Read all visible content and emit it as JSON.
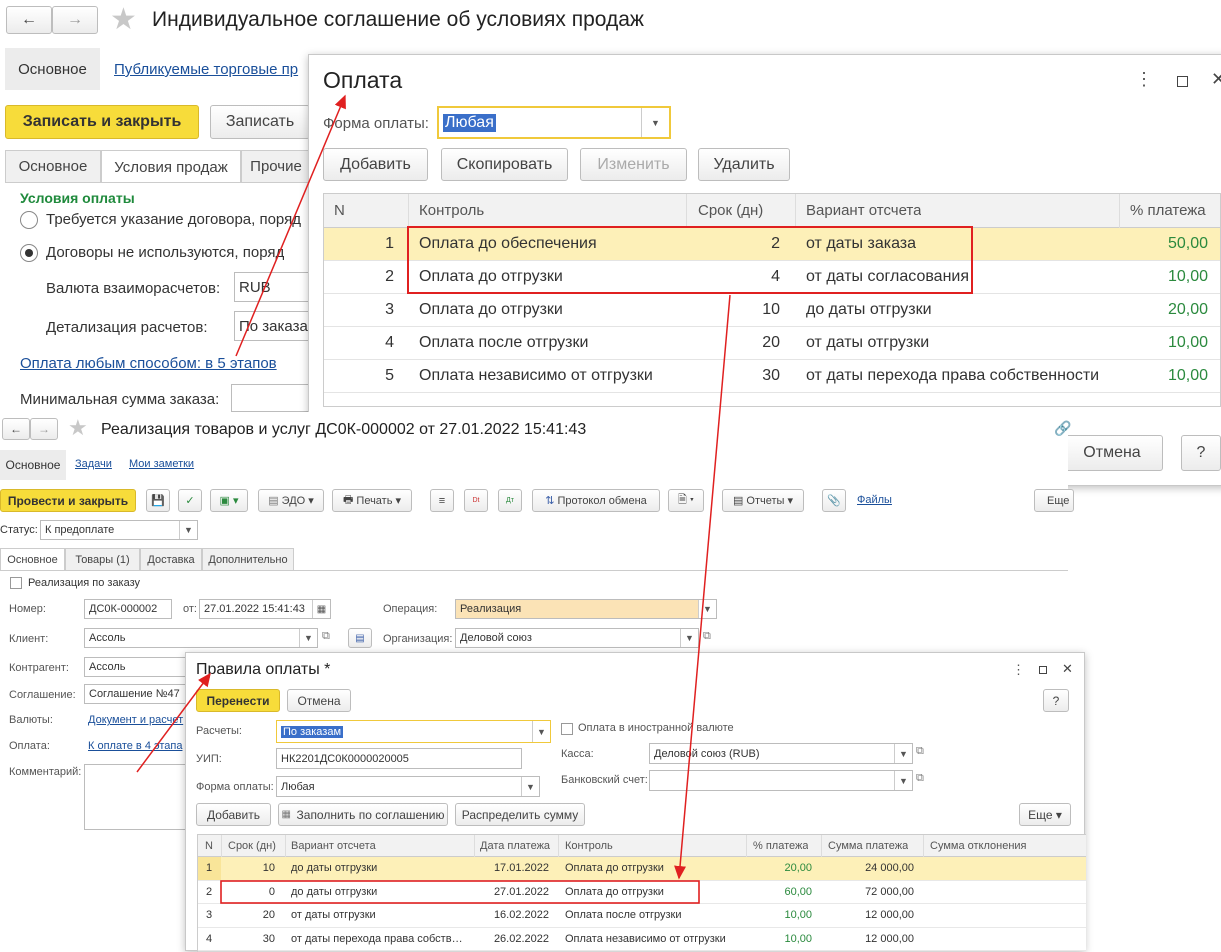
{
  "bg": {
    "title": "Индивидуальное соглашение об условиях продаж",
    "nav_main": "Основное",
    "nav_link": "Публикуемые торговые пр",
    "btn_save_close": "Записать и закрыть",
    "btn_save": "Записать",
    "tabs": [
      "Основное",
      "Условия продаж",
      "Прочие"
    ],
    "section_title": "Условия оплаты",
    "radio1": "Требуется указание договора, поряд",
    "radio2": "Договоры не используются, поряд",
    "currency_label": "Валюта взаиморасчетов:",
    "currency_value": "RUB",
    "detail_label": "Детализация расчетов:",
    "detail_value": "По заказа",
    "payment_link": "Оплата любым способом: в 5 этапов",
    "min_sum_label": "Минимальная сумма заказа:"
  },
  "payment_dialog": {
    "title": "Оплата",
    "form_label": "Форма оплаты:",
    "form_value": "Любая",
    "buttons": [
      "Добавить",
      "Скопировать",
      "Изменить",
      "Удалить"
    ],
    "columns": [
      "N",
      "Контроль",
      "Срок (дн)",
      "Вариант отсчета",
      "% платежа"
    ],
    "rows": [
      {
        "n": "1",
        "control": "Оплата до обеспечения",
        "days": "2",
        "variant": "от даты заказа",
        "pct": "50,00"
      },
      {
        "n": "2",
        "control": "Оплата до отгрузки",
        "days": "4",
        "variant": "от даты согласования",
        "pct": "10,00"
      },
      {
        "n": "3",
        "control": "Оплата до отгрузки",
        "days": "10",
        "variant": "до даты отгрузки",
        "pct": "20,00"
      },
      {
        "n": "4",
        "control": "Оплата после отгрузки",
        "days": "20",
        "variant": "от даты отгрузки",
        "pct": "10,00"
      },
      {
        "n": "5",
        "control": "Оплата независимо от отгрузки",
        "days": "30",
        "variant": "от даты перехода права собственности",
        "pct": "10,00"
      }
    ],
    "cancel": "Отмена",
    "help": "?"
  },
  "doc": {
    "title": "Реализация товаров и услуг ДС0К-000002 от 27.01.2022 15:41:43",
    "nav": [
      "Основное",
      "Задачи",
      "Мои заметки"
    ],
    "btn_post_close": "Провести и закрыть",
    "edo": "ЭДО",
    "print": "Печать",
    "protocol": "Протокол обмена",
    "reports": "Отчеты",
    "files": "Файлы",
    "more": "Еще",
    "status_label": "Статус:",
    "status_value": "К предоплате",
    "tabs": [
      "Основное",
      "Товары (1)",
      "Доставка",
      "Дополнительно"
    ],
    "by_order": "Реализация по заказу",
    "number_label": "Номер:",
    "number_value": "ДС0К-000002",
    "from_label": "от:",
    "date_value": "27.01.2022 15:41:43",
    "operation_label": "Операция:",
    "operation_value": "Реализация",
    "client_label": "Клиент:",
    "client_value": "Ассоль",
    "org_label": "Организация:",
    "org_value": "Деловой союз",
    "contractor_label": "Контрагент:",
    "contractor_value": "Ассоль",
    "agreement_label": "Соглашение:",
    "agreement_value": "Соглашение №47",
    "currency_label": "Валюты:",
    "currency_link": "Документ и расчет",
    "payment_label": "Оплата:",
    "payment_link": "К оплате в 4 этапа",
    "comment_label": "Комментарий:"
  },
  "rules": {
    "title": "Правила оплаты *",
    "btn_transfer": "Перенести",
    "btn_cancel": "Отмена",
    "help": "?",
    "settle_label": "Расчеты:",
    "settle_value": "По заказам",
    "foreign": "Оплата в иностранной валюте",
    "uip_label": "УИП:",
    "uip_value": "НК2201ДС0К0000020005",
    "cash_label": "Касса:",
    "cash_value": "Деловой союз (RUB)",
    "form_label": "Форма оплаты:",
    "form_value": "Любая",
    "bank_label": "Банковский счет:",
    "btn_add": "Добавить",
    "btn_fill": "Заполнить по соглашению",
    "btn_distribute": "Распределить сумму",
    "more": "Еще",
    "columns": [
      "N",
      "Срок (дн)",
      "Вариант отсчета",
      "Дата платежа",
      "Контроль",
      "% платежа",
      "Сумма платежа",
      "Сумма отклонения"
    ],
    "rows": [
      {
        "n": "1",
        "days": "10",
        "variant": "до даты отгрузки",
        "date": "17.01.2022",
        "control": "Оплата до отгрузки",
        "pct": "20,00",
        "sum": "24 000,00"
      },
      {
        "n": "2",
        "days": "0",
        "variant": "до даты отгрузки",
        "date": "27.01.2022",
        "control": "Оплата до отгрузки",
        "pct": "60,00",
        "sum": "72 000,00"
      },
      {
        "n": "3",
        "days": "20",
        "variant": "от даты отгрузки",
        "date": "16.02.2022",
        "control": "Оплата после отгрузки",
        "pct": "10,00",
        "sum": "12 000,00"
      },
      {
        "n": "4",
        "days": "30",
        "variant": "от даты перехода права собств…",
        "date": "26.02.2022",
        "control": "Оплата независимо от отгрузки",
        "pct": "10,00",
        "sum": "12 000,00"
      }
    ]
  },
  "colors": {
    "accent": "#f7dc3a",
    "highlight": "#fdf0b8",
    "annotation": "#e02020",
    "positive": "#2b8a3e"
  }
}
